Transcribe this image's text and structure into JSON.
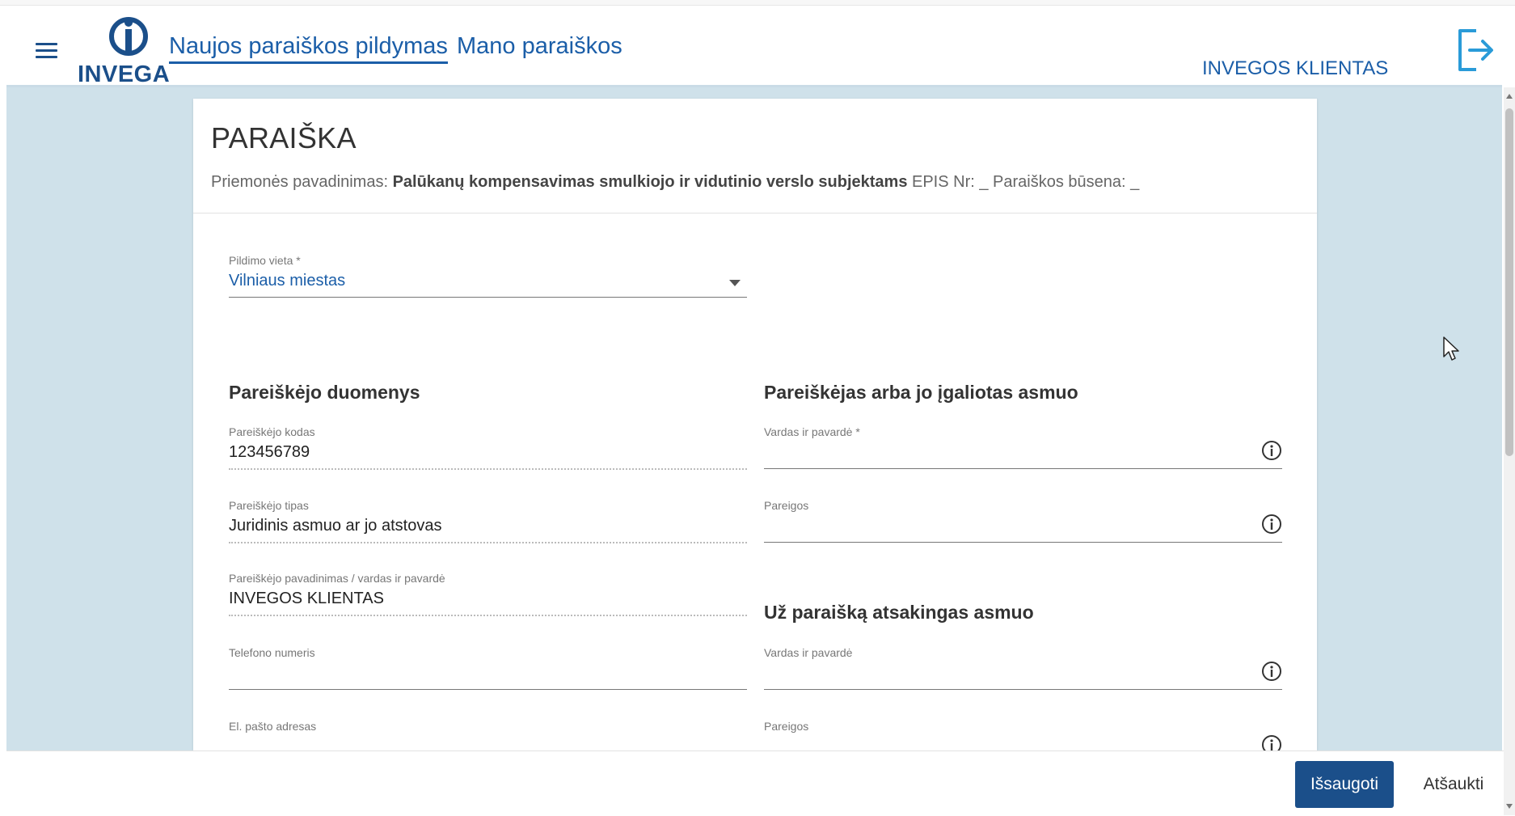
{
  "header": {
    "logo_text": "INVEGA",
    "nav": [
      {
        "label": "Naujos paraiškos pildymas",
        "active": true
      },
      {
        "label": "Mano paraiškos",
        "active": false
      }
    ],
    "user_name": "INVEGOS KLIENTAS",
    "icons": {
      "menu": "hamburger-menu-icon",
      "logout": "logout-icon"
    }
  },
  "card": {
    "title": "PARAIŠKA",
    "subtitle": {
      "measure_label": "Priemonės pavadinimas:",
      "measure_name": "Palūkanų kompensavimas smulkiojo ir vidutinio verslo subjektams",
      "epis_label": "EPIS Nr:",
      "epis_value": "_",
      "status_label": "Paraiškos būsena:",
      "status_value": "_"
    }
  },
  "form": {
    "pildimo_vieta": {
      "label": "Pildimo vieta *",
      "value": "Vilniaus miestas"
    },
    "applicant": {
      "section_title": "Pareiškėjo duomenys",
      "code": {
        "label": "Pareiškėjo kodas",
        "value": "123456789"
      },
      "type": {
        "label": "Pareiškėjo tipas",
        "value": "Juridinis asmuo ar jo atstovas"
      },
      "name": {
        "label": "Pareiškėjo pavadinimas / vardas ir pavardė",
        "value": "INVEGOS KLIENTAS"
      },
      "phone": {
        "label": "Telefono numeris",
        "value": ""
      },
      "email": {
        "label": "El. pašto adresas",
        "value": ""
      }
    },
    "authorized": {
      "section_title": "Pareiškėjas arba jo įgaliotas asmuo",
      "name": {
        "label": "Vardas ir pavardė *",
        "value": ""
      },
      "position": {
        "label": "Pareigos",
        "value": ""
      }
    },
    "responsible": {
      "section_title": "Už paraišką atsakingas asmuo",
      "name": {
        "label": "Vardas ir pavardė",
        "value": ""
      },
      "position": {
        "label": "Pareigos",
        "value": ""
      }
    }
  },
  "footer": {
    "save_label": "Išsaugoti",
    "cancel_label": "Atšaukti"
  },
  "colors": {
    "primary": "#1b4f8a",
    "link": "#1b5ea8",
    "background": "#cfe1ea"
  }
}
